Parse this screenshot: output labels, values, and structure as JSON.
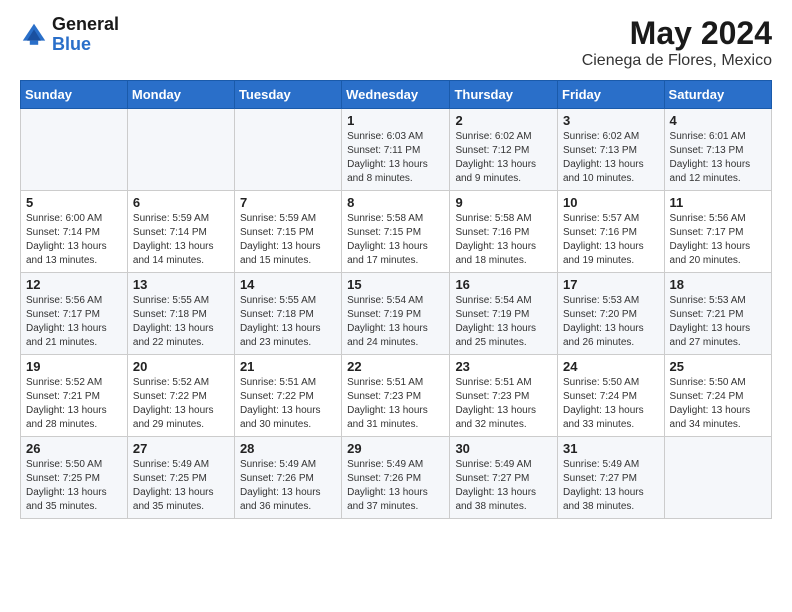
{
  "header": {
    "logo": {
      "general": "General",
      "blue": "Blue"
    },
    "title": "May 2024",
    "location": "Cienega de Flores, Mexico"
  },
  "days_header": [
    "Sunday",
    "Monday",
    "Tuesday",
    "Wednesday",
    "Thursday",
    "Friday",
    "Saturday"
  ],
  "weeks": [
    [
      {
        "day": "",
        "sunrise": "",
        "sunset": "",
        "daylight": ""
      },
      {
        "day": "",
        "sunrise": "",
        "sunset": "",
        "daylight": ""
      },
      {
        "day": "",
        "sunrise": "",
        "sunset": "",
        "daylight": ""
      },
      {
        "day": "1",
        "sunrise": "Sunrise: 6:03 AM",
        "sunset": "Sunset: 7:11 PM",
        "daylight": "Daylight: 13 hours and 8 minutes."
      },
      {
        "day": "2",
        "sunrise": "Sunrise: 6:02 AM",
        "sunset": "Sunset: 7:12 PM",
        "daylight": "Daylight: 13 hours and 9 minutes."
      },
      {
        "day": "3",
        "sunrise": "Sunrise: 6:02 AM",
        "sunset": "Sunset: 7:13 PM",
        "daylight": "Daylight: 13 hours and 10 minutes."
      },
      {
        "day": "4",
        "sunrise": "Sunrise: 6:01 AM",
        "sunset": "Sunset: 7:13 PM",
        "daylight": "Daylight: 13 hours and 12 minutes."
      }
    ],
    [
      {
        "day": "5",
        "sunrise": "Sunrise: 6:00 AM",
        "sunset": "Sunset: 7:14 PM",
        "daylight": "Daylight: 13 hours and 13 minutes."
      },
      {
        "day": "6",
        "sunrise": "Sunrise: 5:59 AM",
        "sunset": "Sunset: 7:14 PM",
        "daylight": "Daylight: 13 hours and 14 minutes."
      },
      {
        "day": "7",
        "sunrise": "Sunrise: 5:59 AM",
        "sunset": "Sunset: 7:15 PM",
        "daylight": "Daylight: 13 hours and 15 minutes."
      },
      {
        "day": "8",
        "sunrise": "Sunrise: 5:58 AM",
        "sunset": "Sunset: 7:15 PM",
        "daylight": "Daylight: 13 hours and 17 minutes."
      },
      {
        "day": "9",
        "sunrise": "Sunrise: 5:58 AM",
        "sunset": "Sunset: 7:16 PM",
        "daylight": "Daylight: 13 hours and 18 minutes."
      },
      {
        "day": "10",
        "sunrise": "Sunrise: 5:57 AM",
        "sunset": "Sunset: 7:16 PM",
        "daylight": "Daylight: 13 hours and 19 minutes."
      },
      {
        "day": "11",
        "sunrise": "Sunrise: 5:56 AM",
        "sunset": "Sunset: 7:17 PM",
        "daylight": "Daylight: 13 hours and 20 minutes."
      }
    ],
    [
      {
        "day": "12",
        "sunrise": "Sunrise: 5:56 AM",
        "sunset": "Sunset: 7:17 PM",
        "daylight": "Daylight: 13 hours and 21 minutes."
      },
      {
        "day": "13",
        "sunrise": "Sunrise: 5:55 AM",
        "sunset": "Sunset: 7:18 PM",
        "daylight": "Daylight: 13 hours and 22 minutes."
      },
      {
        "day": "14",
        "sunrise": "Sunrise: 5:55 AM",
        "sunset": "Sunset: 7:18 PM",
        "daylight": "Daylight: 13 hours and 23 minutes."
      },
      {
        "day": "15",
        "sunrise": "Sunrise: 5:54 AM",
        "sunset": "Sunset: 7:19 PM",
        "daylight": "Daylight: 13 hours and 24 minutes."
      },
      {
        "day": "16",
        "sunrise": "Sunrise: 5:54 AM",
        "sunset": "Sunset: 7:19 PM",
        "daylight": "Daylight: 13 hours and 25 minutes."
      },
      {
        "day": "17",
        "sunrise": "Sunrise: 5:53 AM",
        "sunset": "Sunset: 7:20 PM",
        "daylight": "Daylight: 13 hours and 26 minutes."
      },
      {
        "day": "18",
        "sunrise": "Sunrise: 5:53 AM",
        "sunset": "Sunset: 7:21 PM",
        "daylight": "Daylight: 13 hours and 27 minutes."
      }
    ],
    [
      {
        "day": "19",
        "sunrise": "Sunrise: 5:52 AM",
        "sunset": "Sunset: 7:21 PM",
        "daylight": "Daylight: 13 hours and 28 minutes."
      },
      {
        "day": "20",
        "sunrise": "Sunrise: 5:52 AM",
        "sunset": "Sunset: 7:22 PM",
        "daylight": "Daylight: 13 hours and 29 minutes."
      },
      {
        "day": "21",
        "sunrise": "Sunrise: 5:51 AM",
        "sunset": "Sunset: 7:22 PM",
        "daylight": "Daylight: 13 hours and 30 minutes."
      },
      {
        "day": "22",
        "sunrise": "Sunrise: 5:51 AM",
        "sunset": "Sunset: 7:23 PM",
        "daylight": "Daylight: 13 hours and 31 minutes."
      },
      {
        "day": "23",
        "sunrise": "Sunrise: 5:51 AM",
        "sunset": "Sunset: 7:23 PM",
        "daylight": "Daylight: 13 hours and 32 minutes."
      },
      {
        "day": "24",
        "sunrise": "Sunrise: 5:50 AM",
        "sunset": "Sunset: 7:24 PM",
        "daylight": "Daylight: 13 hours and 33 minutes."
      },
      {
        "day": "25",
        "sunrise": "Sunrise: 5:50 AM",
        "sunset": "Sunset: 7:24 PM",
        "daylight": "Daylight: 13 hours and 34 minutes."
      }
    ],
    [
      {
        "day": "26",
        "sunrise": "Sunrise: 5:50 AM",
        "sunset": "Sunset: 7:25 PM",
        "daylight": "Daylight: 13 hours and 35 minutes."
      },
      {
        "day": "27",
        "sunrise": "Sunrise: 5:49 AM",
        "sunset": "Sunset: 7:25 PM",
        "daylight": "Daylight: 13 hours and 35 minutes."
      },
      {
        "day": "28",
        "sunrise": "Sunrise: 5:49 AM",
        "sunset": "Sunset: 7:26 PM",
        "daylight": "Daylight: 13 hours and 36 minutes."
      },
      {
        "day": "29",
        "sunrise": "Sunrise: 5:49 AM",
        "sunset": "Sunset: 7:26 PM",
        "daylight": "Daylight: 13 hours and 37 minutes."
      },
      {
        "day": "30",
        "sunrise": "Sunrise: 5:49 AM",
        "sunset": "Sunset: 7:27 PM",
        "daylight": "Daylight: 13 hours and 38 minutes."
      },
      {
        "day": "31",
        "sunrise": "Sunrise: 5:49 AM",
        "sunset": "Sunset: 7:27 PM",
        "daylight": "Daylight: 13 hours and 38 minutes."
      },
      {
        "day": "",
        "sunrise": "",
        "sunset": "",
        "daylight": ""
      }
    ]
  ]
}
